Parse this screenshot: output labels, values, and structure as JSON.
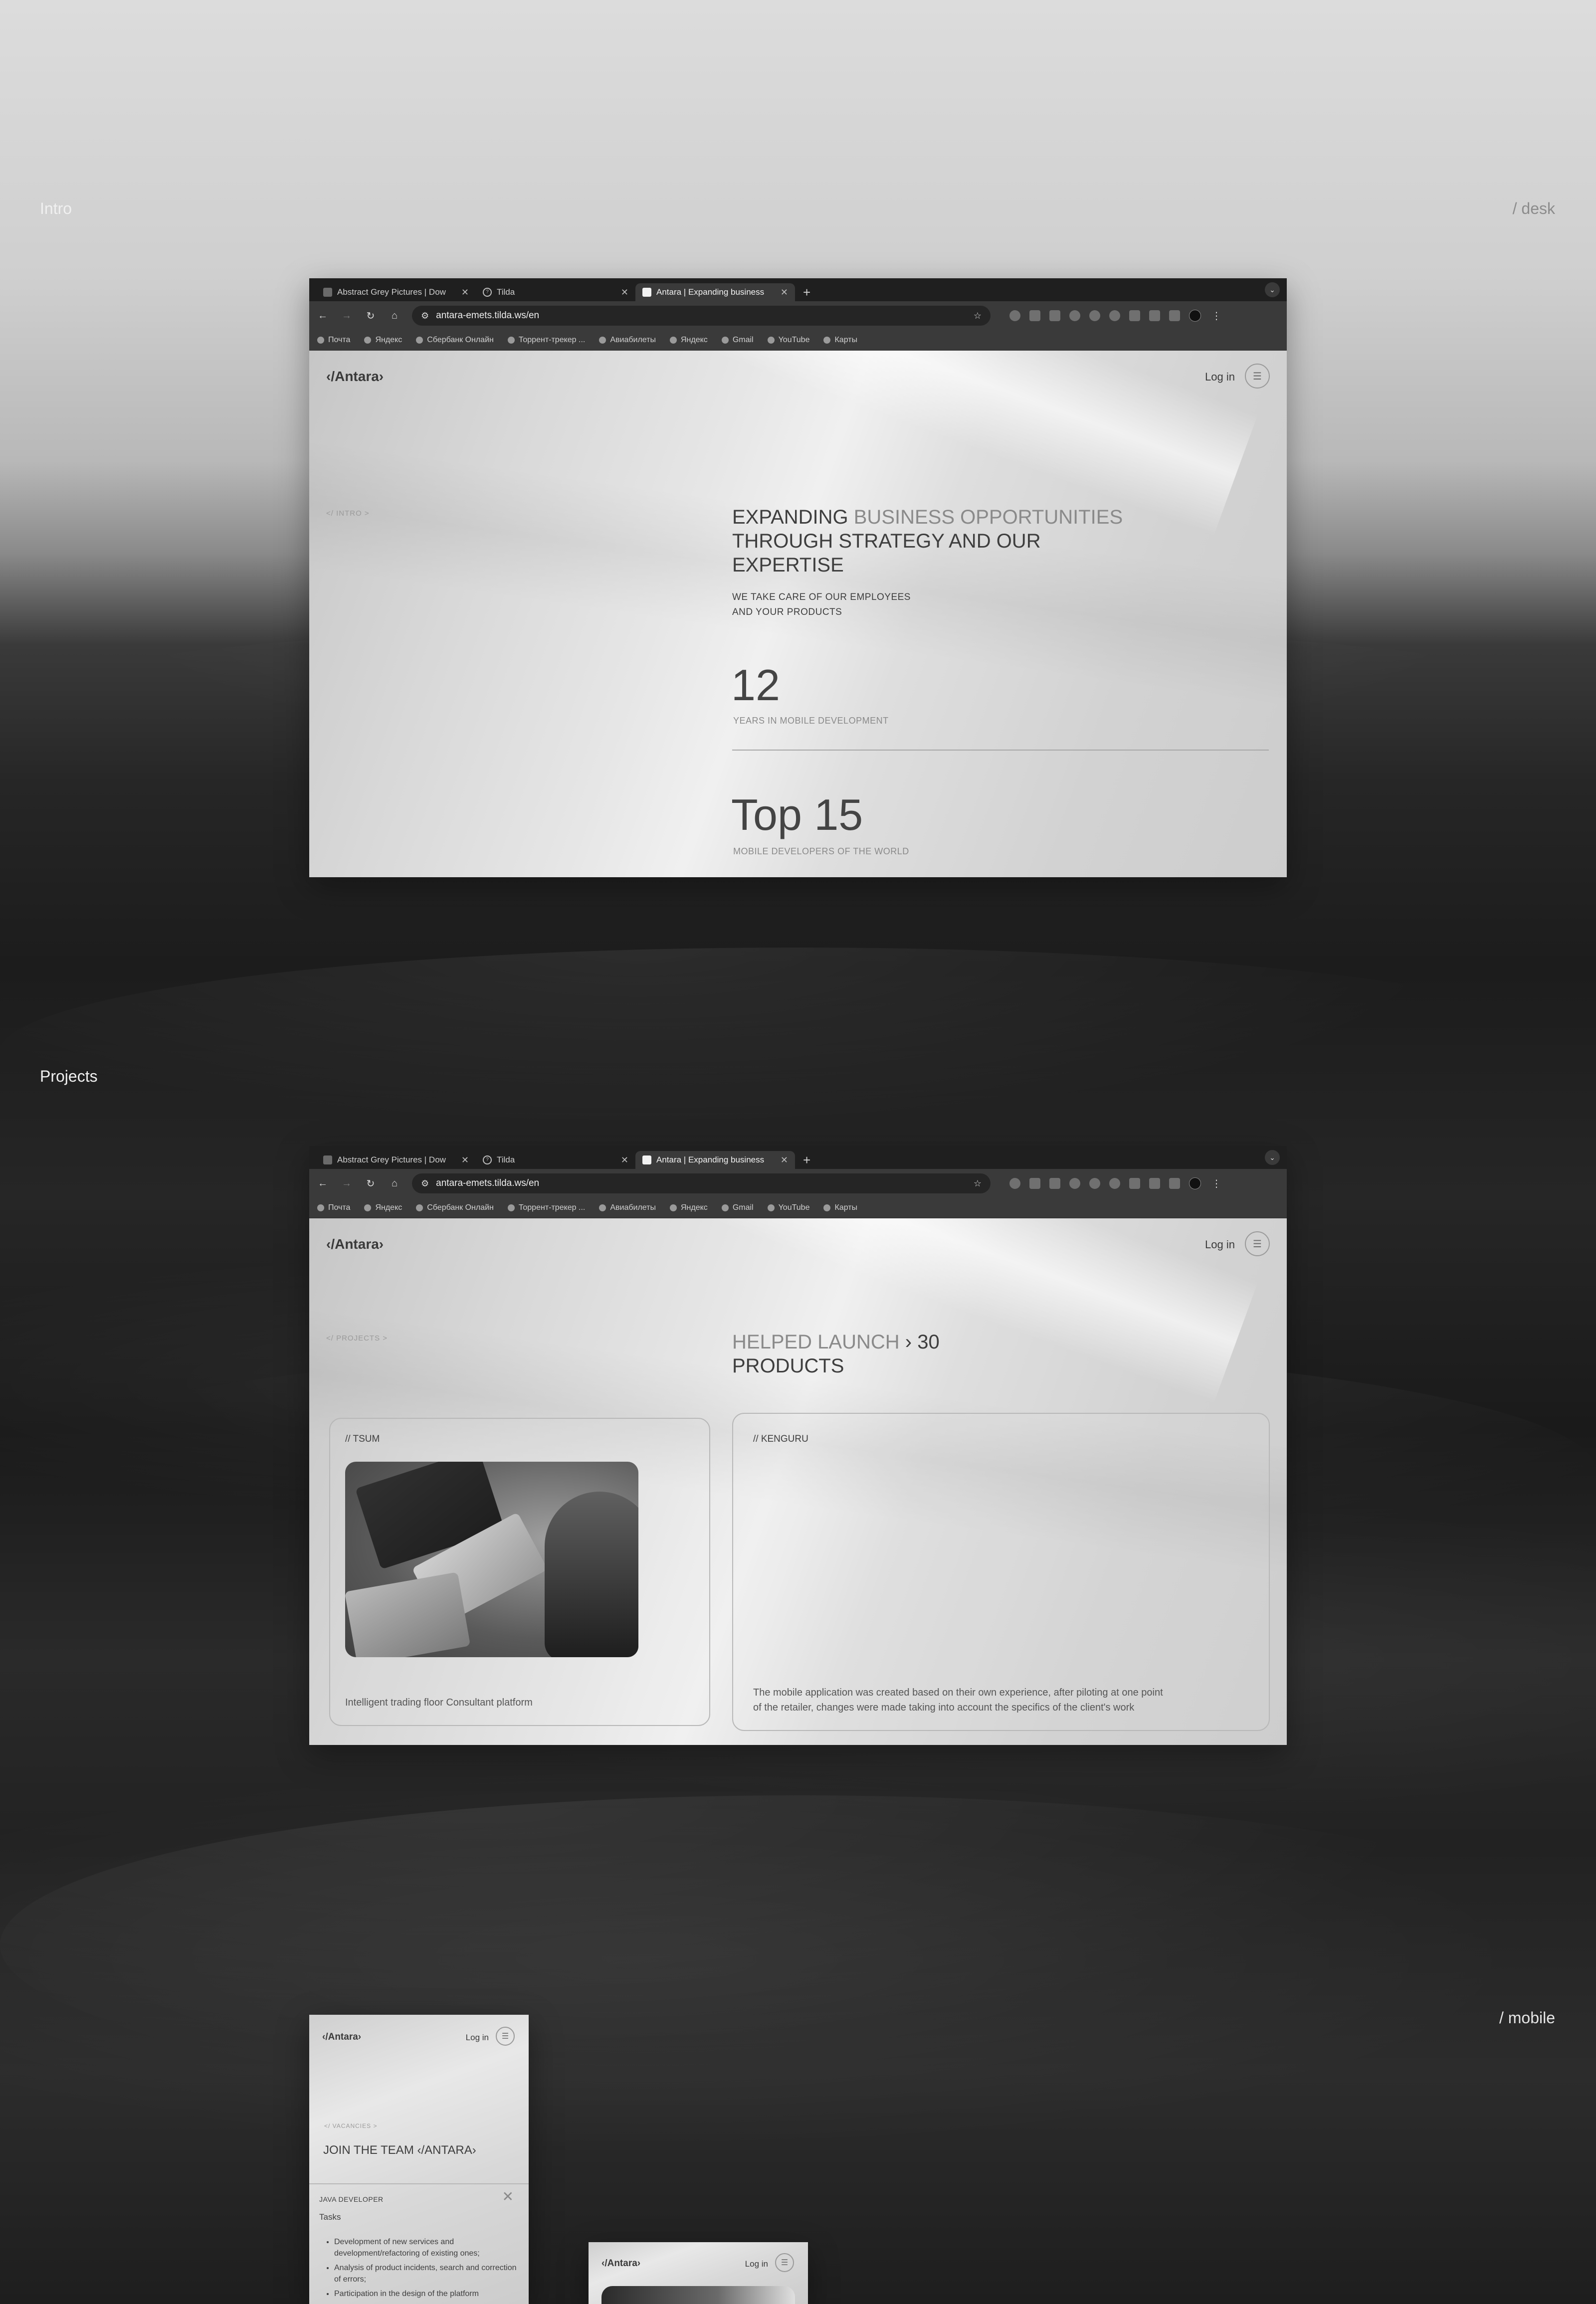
{
  "labels": {
    "intro": "Intro",
    "desk": "/ desk",
    "projects": "Projects",
    "mobile": "/ mobile"
  },
  "browser": {
    "tabs": [
      {
        "title": "Abstract Grey Pictures | Dow",
        "active": false
      },
      {
        "title": "Tilda",
        "active": false
      },
      {
        "title": "Antara | Expanding business",
        "active": true
      }
    ],
    "url": "antara-emets.tilda.ws/en",
    "bookmarks": [
      "Почта",
      "Яндекс",
      "Сбербанк Онлайн",
      "Торрент-трекер ...",
      "Авиабилеты",
      "Яндекс",
      "Gmail",
      "YouTube",
      "Карты"
    ]
  },
  "site": {
    "logo": "‹/Antara›",
    "login": "Log in"
  },
  "intro": {
    "crumb": "</ INTRO >",
    "headline_dark1": "EXPANDING ",
    "headline_muted": "BUSINESS OPPORTUNITIES",
    "headline_line2": "THROUGH STRATEGY AND OUR",
    "headline_line3": "EXPERTISE",
    "sub_line1": "WE TAKE CARE OF OUR EMPLOYEES",
    "sub_line2": "AND YOUR PRODUCTS",
    "stat1_value": "12",
    "stat1_caption": "YEARS IN MOBILE DEVELOPMENT",
    "stat2_value": "Top 15",
    "stat2_caption": "MOBILE DEVELOPERS OF THE WORLD"
  },
  "projects": {
    "crumb": "</ PROJECTS >",
    "headline_muted": "HELPED LAUNCH",
    "headline_dark": " › 30",
    "headline_line2": "PRODUCTS",
    "cards": [
      {
        "title": "// TSUM",
        "text": "Intelligent trading floor Consultant platform"
      },
      {
        "title": "// KENGURU",
        "text_line1": "The mobile application was created based on their own experience, after piloting at one point",
        "text_line2": "of the retailer, changes were made taking into account the specifics of the client's work"
      }
    ]
  },
  "mobile": {
    "crumb": "</ VACANCIES >",
    "title": "JOIN THE TEAM ‹/ANTARA›",
    "vacancy": "JAVA DEVELOPER",
    "tasks_label": "Tasks",
    "tasks": [
      "Development of new services and development/refactoring of existing ones;",
      "Analysis of product incidents, search and correction of errors;",
      "Participation in the design of the platform"
    ]
  },
  "colors": {
    "dark_text": "#3e3e3e",
    "muted_text": "#8a8a8a",
    "chrome_dark": "#1f1f1f",
    "chrome_toolbar": "#3a3a3a"
  }
}
